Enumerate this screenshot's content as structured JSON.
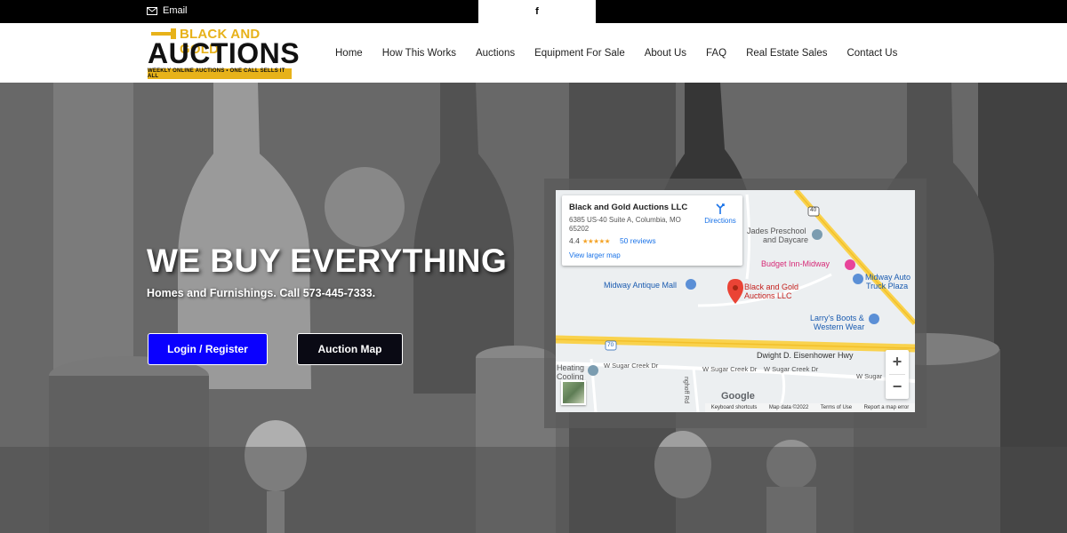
{
  "topbar": {
    "email_label": "Email",
    "social_label": "f"
  },
  "logo": {
    "line1": "BLACK AND GOLD",
    "line2": "AUCTIONS",
    "tagline": "WEEKLY ONLINE AUCTIONS • ONE CALL SELLS IT ALL"
  },
  "nav": {
    "items": [
      {
        "label": "Home"
      },
      {
        "label": "How This Works"
      },
      {
        "label": "Auctions"
      },
      {
        "label": "Equipment For Sale"
      },
      {
        "label": "About Us"
      },
      {
        "label": "FAQ"
      },
      {
        "label": "Real Estate Sales"
      },
      {
        "label": "Contact Us"
      }
    ]
  },
  "hero": {
    "title": "WE BUY EVERYTHING",
    "subtitle": "Homes and Furnishings. Call 573-445-7333.",
    "login_button": "Login / Register",
    "map_button": "Auction Map"
  },
  "map": {
    "card": {
      "name": "Black and Gold Auctions LLC",
      "address": "6385 US-40 Suite A, Columbia, MO 65202",
      "rating": "4.4",
      "stars": "★★★★★",
      "reviews": "50 reviews",
      "larger_map": "View larger map",
      "directions": "Directions"
    },
    "labels": {
      "jades": "Jades Preschool",
      "jades2": "and Daycare",
      "budget": "Budget Inn-Midway",
      "midway_auto": "Midway Auto",
      "truck_plaza": "Truck Plaza",
      "antique": "Midway Antique Mall",
      "pin1": "Black and Gold",
      "pin2": "Auctions LLC",
      "larrys": "Larry's Boots &",
      "western": "Western Wear",
      "highway": "Dwight D. Eisenhower Hwy",
      "sugar1": "W Sugar Creek Dr",
      "sugar2": "W Sugar Creek Dr",
      "sugar3": "W Sugar Creek Dr",
      "sugar4": "W Sugar",
      "heating": "Heating",
      "cooling": "Cooling",
      "road_40": "40",
      "road_70": "70",
      "ghoff": "nghoff Rd"
    },
    "google": "Google",
    "footer": {
      "shortcuts": "Keyboard shortcuts",
      "mapdata": "Map data ©2022",
      "terms": "Terms of Use",
      "report": "Report a map error"
    },
    "zoom_in": "+",
    "zoom_out": "−"
  }
}
